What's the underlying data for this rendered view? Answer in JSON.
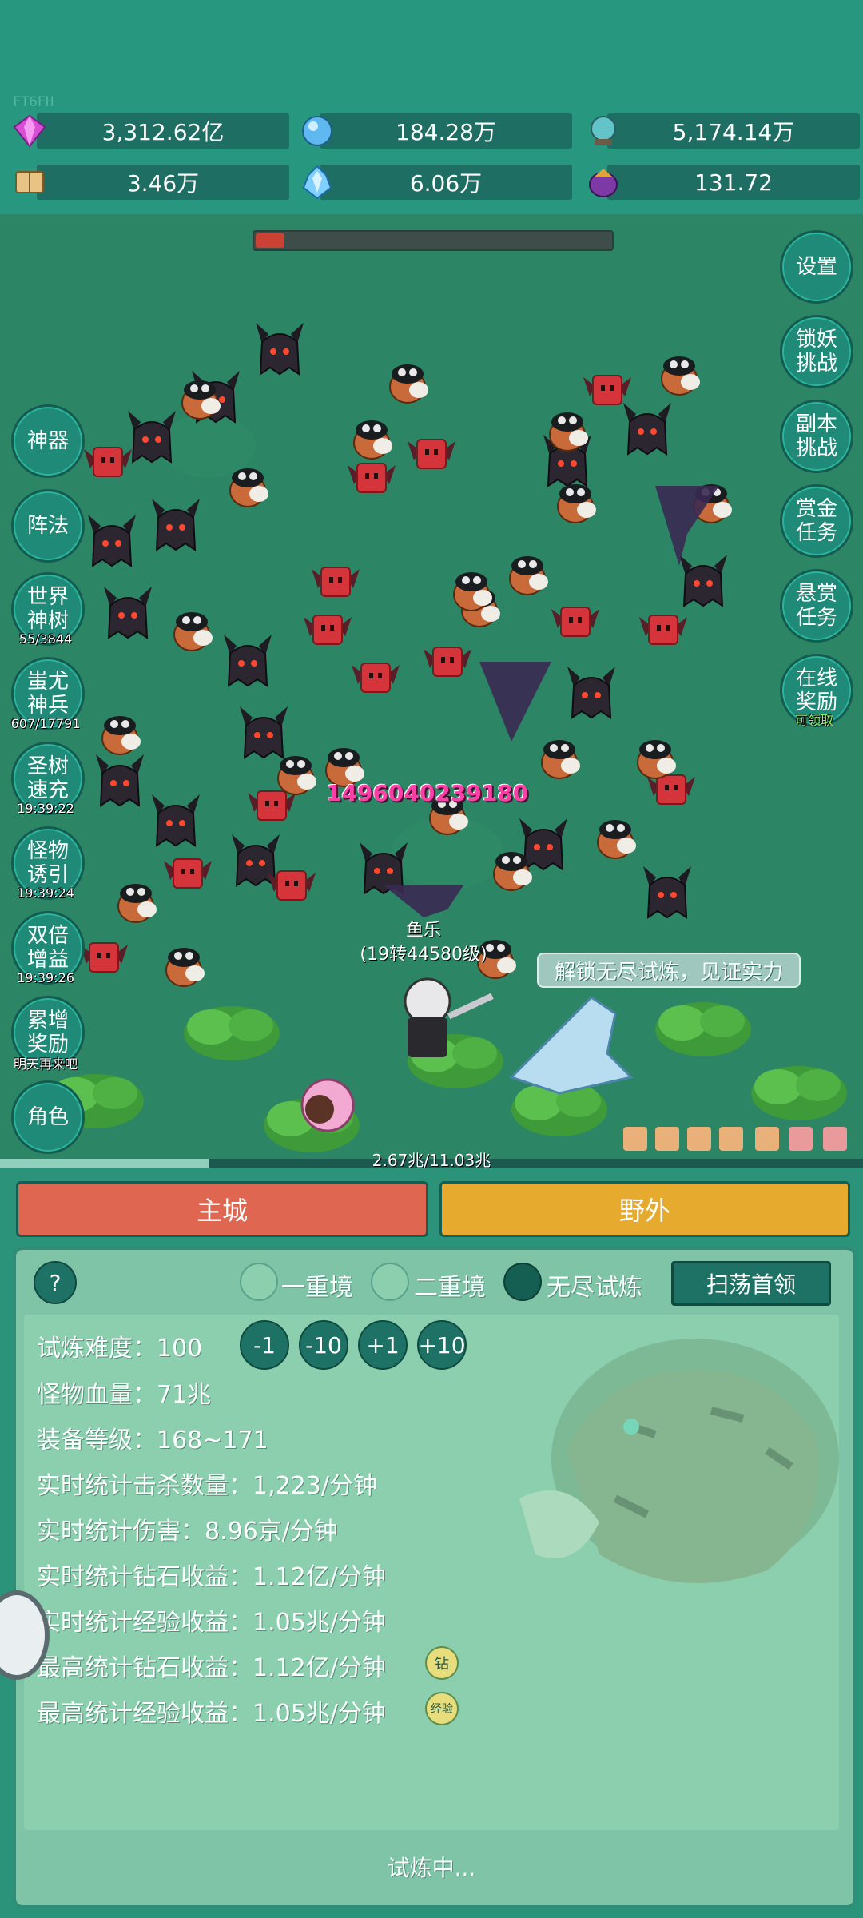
{
  "watermark": "FT6FH",
  "resources": [
    {
      "icon": "diamond-icon",
      "value": "3,312.62亿"
    },
    {
      "icon": "blue-gem-icon",
      "value": "184.28万"
    },
    {
      "icon": "crystal-ball-icon",
      "value": "5,174.14万"
    },
    {
      "icon": "book-icon",
      "value": "3.46万"
    },
    {
      "icon": "ice-crystal-icon",
      "value": "6.06万"
    },
    {
      "icon": "purple-orb-icon",
      "value": "131.72"
    }
  ],
  "boss_hp_fraction": 0.08,
  "left_menu": [
    {
      "label": "神器",
      "sub": ""
    },
    {
      "label": "阵法",
      "sub": ""
    },
    {
      "label": "世界\n神树",
      "sub": "55/3844"
    },
    {
      "label": "蚩尤\n神兵",
      "sub": "607/17791"
    },
    {
      "label": "圣树\n速充",
      "sub": "19:39:22"
    },
    {
      "label": "怪物\n诱引",
      "sub": "19:39:24"
    },
    {
      "label": "双倍\n增益",
      "sub": "19:39:26"
    },
    {
      "label": "累增\n奖励",
      "sub": "明天再来吧"
    },
    {
      "label": "角色",
      "sub": ""
    }
  ],
  "right_menu": [
    {
      "label": "设置",
      "sub": ""
    },
    {
      "label": "锁妖\n挑战",
      "sub": ""
    },
    {
      "label": "副本\n挑战",
      "sub": ""
    },
    {
      "label": "赏金\n任务",
      "sub": ""
    },
    {
      "label": "悬赏\n任务",
      "sub": ""
    },
    {
      "label": "在线\n奖励",
      "sub": "可领取"
    }
  ],
  "battle": {
    "damage_number": "1496040239180",
    "player_name": "鱼乐",
    "player_level": "(19转44580级)",
    "bubble": "解锁无尽试炼，见证实力"
  },
  "xp": {
    "text": "2.67兆/11.03兆",
    "fraction": 0.242
  },
  "tabs": {
    "main_city": "主城",
    "wild": "野外"
  },
  "panel": {
    "help": "?",
    "modes": [
      {
        "label": "一重境",
        "selected": false
      },
      {
        "label": "二重境",
        "selected": false
      },
      {
        "label": "无尽试炼",
        "selected": true
      }
    ],
    "sweep_button": "扫荡首领",
    "difficulty_label": "试炼难度：100",
    "steps": [
      "-1",
      "-10",
      "+1",
      "+10"
    ],
    "stats": [
      "怪物血量：71兆",
      "装备等级：168~171",
      "实时统计击杀数量：1,223/分钟",
      "实时统计伤害：8.96京/分钟",
      "实时统计钻石收益：1.12亿/分钟",
      "实时统计经验收益：1.05兆/分钟",
      "最高统计钻石收益：1.12亿/分钟",
      "最高统计经验收益：1.05兆/分钟"
    ],
    "badges": {
      "diamond": "钻",
      "exp": "经验"
    },
    "status": "试炼中..."
  },
  "colors": {
    "bg": "#27947f",
    "main_city": "#df6650",
    "wild": "#e6ab2e",
    "accent": "#1d7265"
  }
}
